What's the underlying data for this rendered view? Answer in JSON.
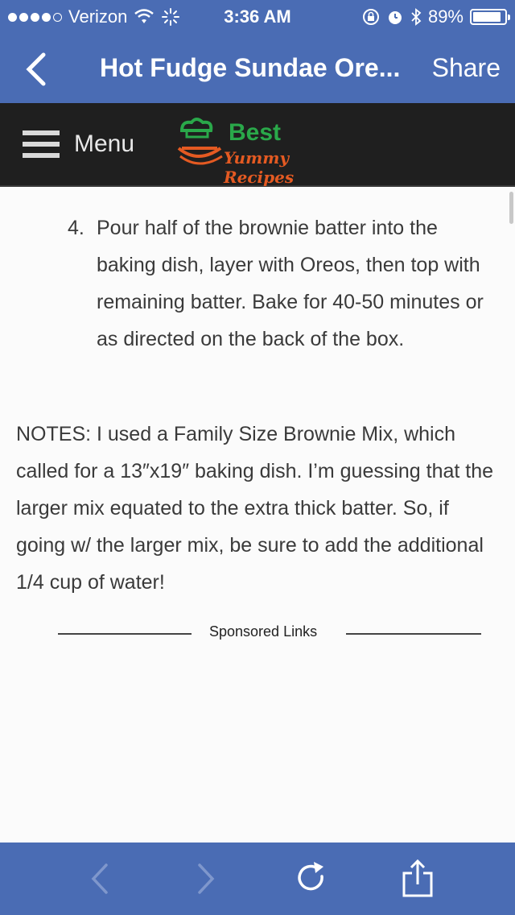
{
  "status_bar": {
    "carrier": "Verizon",
    "time": "3:36 AM",
    "battery_percent": "89%",
    "battery_level": 0.89,
    "signal_bars_filled": 4
  },
  "nav_bar": {
    "title": "Hot Fudge Sundae Ore...",
    "share_label": "Share",
    "back_icon": "chevron-left-icon"
  },
  "site_header": {
    "menu_label": "Menu",
    "logo_line1": "Best",
    "logo_line2": "Yummy Recipes"
  },
  "content": {
    "step_number": "4.",
    "step_text": "Pour half of the brownie batter into the baking dish, layer with Oreos, then top with remaining batter. Bake for 40-50 minutes or as directed on the back of the box.",
    "notes": "NOTES: I used a Family Size Brownie Mix, which called for a 13″x19″ baking dish. I’m guessing that the larger mix equated to the extra thick batter. So, if going w/ the larger mix, be sure to add the additional 1/4 cup of water!",
    "sponsored_label": "Sponsored Links"
  },
  "toolbar": {
    "icons": [
      "back-arrow-icon",
      "forward-arrow-icon",
      "reload-icon",
      "share-icon"
    ]
  },
  "colors": {
    "bar_blue": "#4a6cb4",
    "header_dark": "#1f1f1f",
    "logo_green": "#2aa84a",
    "logo_orange": "#e45a22"
  }
}
